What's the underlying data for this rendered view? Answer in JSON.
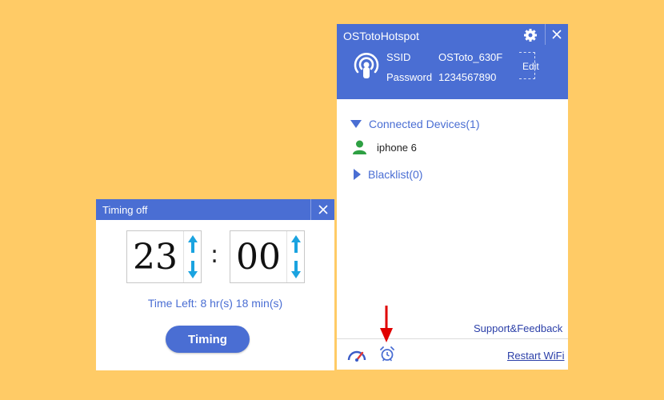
{
  "timing_dialog": {
    "title": "Timing off",
    "hours": "23",
    "minutes": "00",
    "separator": ":",
    "time_left": "Time Left: 8 hr(s) 18 min(s)",
    "button_label": "Timing"
  },
  "hotspot": {
    "title": "OSTotoHotspot",
    "ssid_label": "SSID",
    "ssid_value": "OSToto_630F",
    "password_label": "Password",
    "password_value": "1234567890",
    "edit_label": "Edit",
    "connected_devices_label": "Connected Devices(1)",
    "devices": [
      "iphone 6"
    ],
    "blacklist_label": "Blacklist(0)",
    "support_label": "Support&Feedback",
    "restart_label": "Restart WiFi"
  },
  "colors": {
    "background": "#FFCB66",
    "accent": "#4A6ED3",
    "link": "#2B3FA8",
    "arrow": "#E00000",
    "device_icon": "#2EA043",
    "spinner_arrow": "#1AA3E0"
  }
}
